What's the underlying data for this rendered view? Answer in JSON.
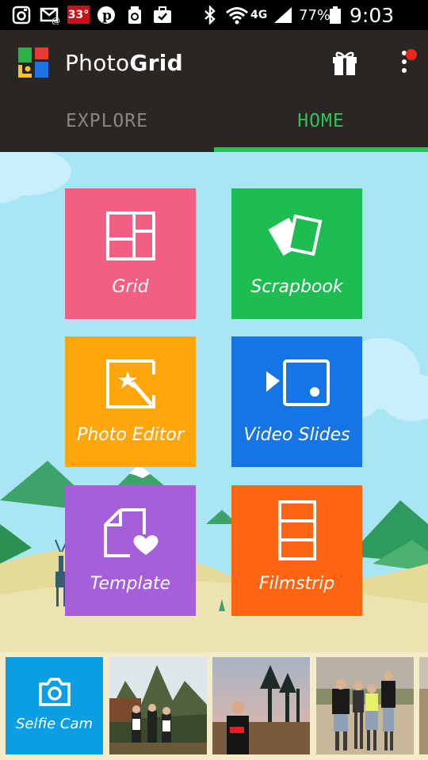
{
  "status_bar": {
    "temperature": "33°",
    "network": "4G",
    "battery": "77%",
    "time": "9:03 AM",
    "icons": [
      "instagram-icon",
      "messaging-icon",
      "pinterest-icon",
      "recycle-icon",
      "briefcase-icon",
      "bluetooth-icon",
      "wifi-icon",
      "signal-icon",
      "battery-icon"
    ]
  },
  "app_bar": {
    "title_regular": "Photo",
    "title_bold": "Grid",
    "icons": [
      "photogrid-logo",
      "gift-icon",
      "more-menu-icon"
    ],
    "notification_dot_color": "#e8261c"
  },
  "tabs": [
    {
      "label": "EXPLORE",
      "selected": false
    },
    {
      "label": "HOME",
      "selected": true
    }
  ],
  "accent_color": "#27c25a",
  "tiles": [
    {
      "label": "Grid",
      "color": "#f35e83",
      "icon": "grid-icon"
    },
    {
      "label": "Scrapbook",
      "color": "#1ebd52",
      "icon": "scrapbook-icon"
    },
    {
      "label": "Photo Editor",
      "color": "#ffa60d",
      "icon": "photo-editor-icon"
    },
    {
      "label": "Video Slides",
      "color": "#1675e4",
      "icon": "video-slides-icon"
    },
    {
      "label": "Template",
      "color": "#a55fd9",
      "icon": "template-icon"
    },
    {
      "label": "Filmstrip",
      "color": "#ff6411",
      "icon": "filmstrip-icon"
    }
  ],
  "bottom_strip": {
    "selfie_label": "Selfie Cam",
    "selfie_color": "#0c9ee3",
    "thumbnails": [
      "mountain-group-photo",
      "sunset-portrait-photo",
      "family-photo",
      "partial-photo"
    ]
  }
}
